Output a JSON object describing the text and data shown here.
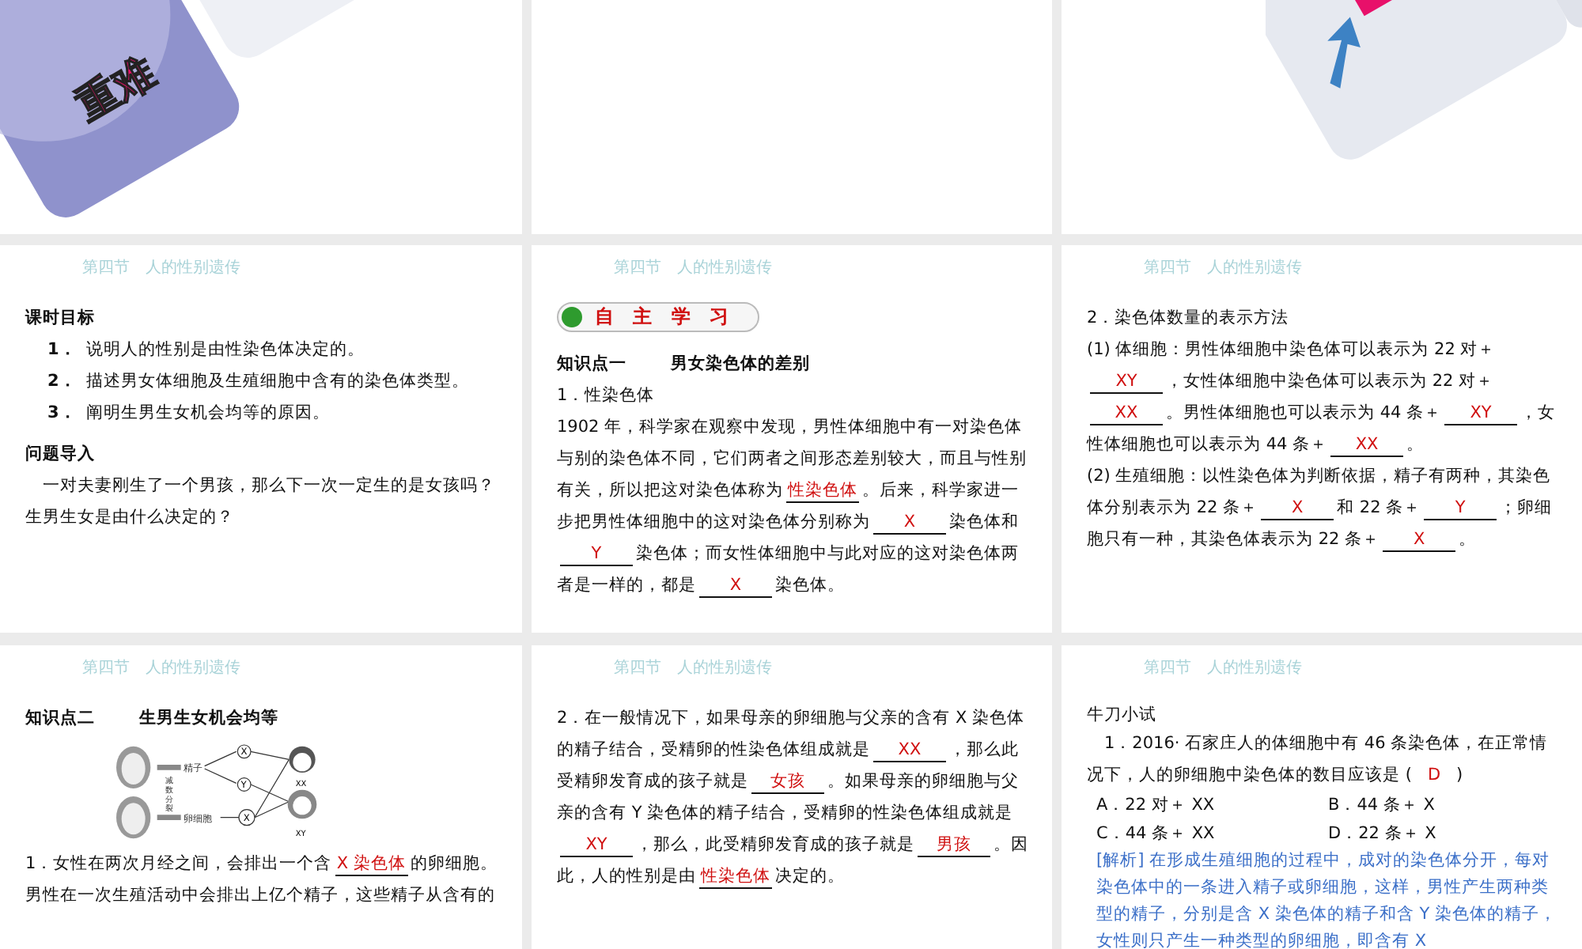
{
  "top_row": [
    {
      "kind": "banner",
      "label": "重难"
    },
    {
      "kind": "plain"
    },
    {
      "kind": "arrow_banner"
    }
  ],
  "slides": [
    {
      "header": "第四节　人的性别遗传",
      "blocks": [
        {
          "kind": "title",
          "texts": [
            "课时目标"
          ]
        },
        {
          "kind": "item",
          "number": "1．",
          "text": "说明人的性别是由性染色体决定的。"
        },
        {
          "kind": "item",
          "number": "2．",
          "text": "描述男女体细胞及生殖细胞中含有的染色体类型。"
        },
        {
          "kind": "item",
          "number": "3．",
          "text": "阐明生男生女机会均等的原因。"
        },
        {
          "kind": "title",
          "texts": [
            "问题导入"
          ]
        },
        {
          "kind": "para",
          "parts": [
            {
              "kind": "text",
              "text": "　一对夫妻刚生了一个男孩，那么下一次一定生的是女孩吗？生男生女是由什么决定的？"
            }
          ]
        }
      ]
    },
    {
      "header": "第四节　人的性别遗传",
      "blocks": [
        {
          "kind": "badge",
          "text": "自 主 学 习"
        },
        {
          "kind": "title",
          "texts": [
            "知识点一",
            "男女染色体的差别"
          ]
        },
        {
          "kind": "para",
          "parts": [
            {
              "kind": "text",
              "text": "1．性染色体"
            }
          ]
        },
        {
          "kind": "para",
          "parts": [
            {
              "kind": "text",
              "text": "1902 年，科学家在观察中发现，男性体细胞中有一对染色体与别的染色体不同，它们两者之间形态差别较大，而且与性别有关，所以把这对染色体称为"
            },
            {
              "kind": "blank",
              "answer": "性染色体"
            },
            {
              "kind": "text",
              "text": "。后来，科学家进一步把男性体细胞中的这对染色体分别称为"
            },
            {
              "kind": "blank",
              "answer": "X"
            },
            {
              "kind": "text",
              "text": "染色体和"
            },
            {
              "kind": "blank",
              "answer": "Y"
            },
            {
              "kind": "text",
              "text": "染色体；而女性体细胞中与此对应的这对染色体两者是一样的，都是"
            },
            {
              "kind": "blank",
              "answer": "X"
            },
            {
              "kind": "text",
              "text": "染色体。"
            }
          ]
        }
      ]
    },
    {
      "header": "第四节　人的性别遗传",
      "blocks": [
        {
          "kind": "para",
          "parts": [
            {
              "kind": "text",
              "text": "2．染色体数量的表示方法"
            }
          ]
        },
        {
          "kind": "para",
          "parts": [
            {
              "kind": "text",
              "text": "(1) 体细胞：男性体细胞中染色体可以表示为 22 对＋"
            },
            {
              "kind": "blank",
              "answer": "XY"
            },
            {
              "kind": "text",
              "text": "，女性体细胞中染色体可以表示为 22 对＋"
            },
            {
              "kind": "blank",
              "answer": "XX"
            },
            {
              "kind": "text",
              "text": "。男性体细胞也可以表示为 44 条＋"
            },
            {
              "kind": "blank",
              "answer": "XY"
            },
            {
              "kind": "text",
              "text": "，女性体细胞也可以表示为 44 条＋"
            },
            {
              "kind": "blank",
              "answer": "XX"
            },
            {
              "kind": "text",
              "text": "。"
            }
          ]
        },
        {
          "kind": "para",
          "parts": [
            {
              "kind": "text",
              "text": "(2) 生殖细胞：以性染色体为判断依据，精子有两种，其染色体分别表示为 22 条＋"
            },
            {
              "kind": "blank",
              "answer": "X"
            },
            {
              "kind": "text",
              "text": "和 22 条＋"
            },
            {
              "kind": "blank",
              "answer": "Y"
            },
            {
              "kind": "text",
              "text": "；卵细胞只有一种，其染色体表示为 22 条＋"
            },
            {
              "kind": "blank",
              "answer": "X"
            },
            {
              "kind": "text",
              "text": "。"
            }
          ]
        }
      ]
    },
    {
      "header": "第四节　人的性别遗传",
      "blocks": [
        {
          "kind": "title",
          "texts": [
            "知识点二",
            "生男生女机会均等"
          ]
        },
        {
          "kind": "diagram",
          "sperm": "精子",
          "egg": "卵细胞",
          "division": "减数分裂",
          "sperm_types": [
            "X",
            "Y"
          ],
          "egg_type": "X",
          "children": [
            "XX",
            "XY"
          ]
        },
        {
          "kind": "para",
          "parts": [
            {
              "kind": "text",
              "text": "1．女性在两次月经之间，会排出一个含"
            },
            {
              "kind": "blank",
              "answer": "X 染色体"
            },
            {
              "kind": "text",
              "text": "的卵细胞。男性在一次生殖活动中会排出上亿个精子，这些精子从含有的"
            }
          ]
        }
      ]
    },
    {
      "header": "第四节　人的性别遗传",
      "blocks": [
        {
          "kind": "para",
          "parts": [
            {
              "kind": "text",
              "text": "2．在一般情况下，如果母亲的卵细胞与父亲的含有 X 染色体的精子结合，受精卵的性染色体组成就是"
            },
            {
              "kind": "blank",
              "answer": "XX"
            },
            {
              "kind": "text",
              "text": "，那么此受精卵发育成的孩子就是"
            },
            {
              "kind": "blank",
              "answer": "女孩"
            },
            {
              "kind": "text",
              "text": "。如果母亲的卵细胞与父亲的含有 Y 染色体的精子结合，受精卵的性染色体组成就是"
            },
            {
              "kind": "blank",
              "answer": "XY"
            },
            {
              "kind": "text",
              "text": "，那么，此受精卵发育成的孩子就是"
            },
            {
              "kind": "blank",
              "answer": "男孩"
            },
            {
              "kind": "text",
              "text": "。因此，人的性别是由"
            },
            {
              "kind": "blank",
              "answer": "性染色体"
            },
            {
              "kind": "text",
              "text": "决定的。"
            }
          ]
        }
      ]
    },
    {
      "header": "第四节　人的性别遗传",
      "blocks": [
        {
          "kind": "plain",
          "text": "牛刀小试"
        },
        {
          "kind": "para",
          "parts": [
            {
              "kind": "text",
              "text": "　1．2016· 石家庄人的体细胞中有 46 条染色体，在正常情况下，人的卵细胞中染色体的数目应该是 ("
            },
            {
              "kind": "answer",
              "answer": "D"
            },
            {
              "kind": "text",
              "text": ")"
            }
          ]
        },
        {
          "kind": "options",
          "options": [
            "A．22 对＋ XX",
            "B．44 条＋ X",
            "C．44 条＋ XX",
            "D．22 条＋ X"
          ]
        },
        {
          "kind": "analysis",
          "text": "[解析] 在形成生殖细胞的过程中，成对的染色体分开，每对染色体中的一条进入精子或卵细胞，这样，男性产生两种类型的精子，分别是含 X 染色体的精子和含 Y 染色体的精子，女性则只产生一种类型的卵细胞，即含有 X"
        }
      ]
    }
  ]
}
